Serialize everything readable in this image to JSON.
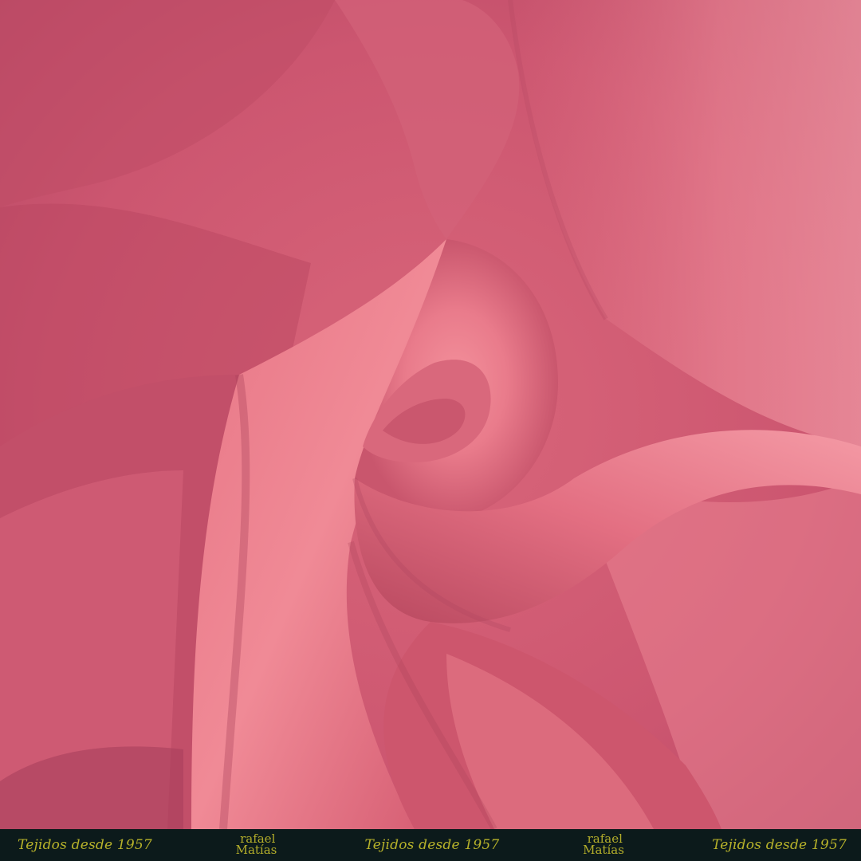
{
  "image": {
    "subject": "pink-chiffon-fabric-swirl",
    "colors": {
      "base": "#cf5a72",
      "highlight": "#f08c98",
      "shadow": "#a43f58",
      "deep_shadow": "#7e2c44",
      "footer_bg": "#0c1a1b",
      "footer_text": "#b7b22a"
    }
  },
  "footer": {
    "tagline_1": "Tejidos desde 1957",
    "logo_1_line_1": "rafael",
    "logo_1_line_2": "Matías",
    "tagline_2": "Tejidos desde 1957",
    "logo_2_line_1": "rafael",
    "logo_2_line_2": "Matías",
    "tagline_3": "Tejidos desde 1957"
  }
}
